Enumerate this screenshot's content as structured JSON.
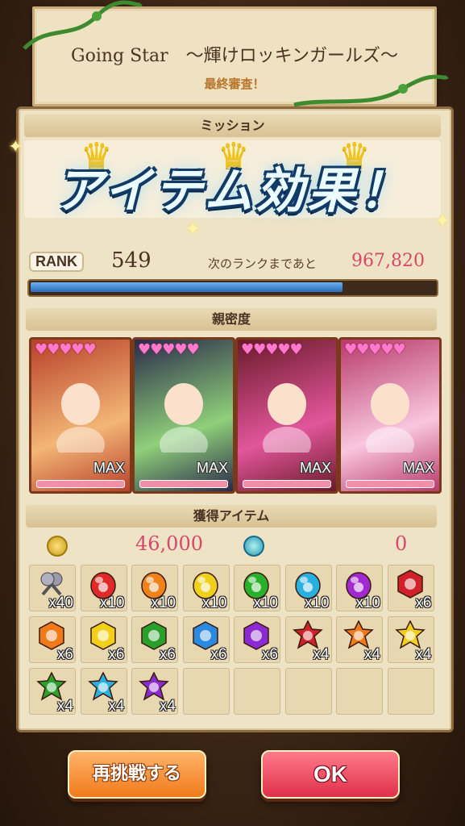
{
  "banner": {
    "title": "Going Star　〜輝けロッキンガールズ〜",
    "subtitle": "最終審査！"
  },
  "mission": {
    "header": "ミッション",
    "crowns": 3,
    "crown_icon": "crown-icon"
  },
  "overlay": {
    "text": "アイテム効果！"
  },
  "rank": {
    "label": "RANK",
    "value": "549",
    "next_label": "次のランクまであと",
    "next_value": "967,820",
    "progress": 0.77
  },
  "affinity": {
    "header": "親密度",
    "cards": [
      {
        "hearts": "♥♥♥♥♥",
        "max": "MAX",
        "colors": [
          "#b8402a",
          "#f3b676"
        ]
      },
      {
        "hearts": "♥♥♥♥♥",
        "max": "MAX",
        "colors": [
          "#2a2a4a",
          "#8fd07a"
        ]
      },
      {
        "hearts": "♥♥♥♥♥",
        "max": "MAX",
        "colors": [
          "#6a1a2a",
          "#e2569a"
        ]
      },
      {
        "hearts": "♥♥♥♥♥",
        "max": "MAX",
        "colors": [
          "#b83a6a",
          "#f9c6e0"
        ]
      }
    ]
  },
  "items": {
    "header": "獲得アイテム",
    "coin_icon": "coin-icon",
    "coin_value": "46,000",
    "gem_icon": "blue-swirl-icon",
    "gem_value": "0",
    "grid": [
      {
        "icon": "microphone-icon",
        "color": "#7a7a8a",
        "count": "x40"
      },
      {
        "icon": "red-egg-icon",
        "color": "#e02a2a",
        "count": "x10"
      },
      {
        "icon": "orange-egg-icon",
        "color": "#f0821a",
        "count": "x10"
      },
      {
        "icon": "yellow-egg-icon",
        "color": "#f0d01a",
        "count": "x10"
      },
      {
        "icon": "green-egg-icon",
        "color": "#2ab02a",
        "count": "x10"
      },
      {
        "icon": "cyan-egg-icon",
        "color": "#2ab0e0",
        "count": "x10"
      },
      {
        "icon": "purple-egg-icon",
        "color": "#a02ad0",
        "count": "x10"
      },
      {
        "icon": "red-hex-gem-icon",
        "color": "#d0202a",
        "count": "x6"
      },
      {
        "icon": "orange-hex-gem-icon",
        "color": "#f07a1a",
        "count": "x6"
      },
      {
        "icon": "yellow-hex-gem-icon",
        "color": "#f0d01a",
        "count": "x6"
      },
      {
        "icon": "green-hex-gem-icon",
        "color": "#2aa02a",
        "count": "x6"
      },
      {
        "icon": "blue-hex-gem-icon",
        "color": "#2a8ae0",
        "count": "x6"
      },
      {
        "icon": "purple-hex-gem-icon",
        "color": "#8a2ad0",
        "count": "x6"
      },
      {
        "icon": "red-star-gem-icon",
        "color": "#d0202a",
        "count": "x4"
      },
      {
        "icon": "orange-star-gem-icon",
        "color": "#f07a1a",
        "count": "x4"
      },
      {
        "icon": "yellow-star-gem-icon",
        "color": "#f0d01a",
        "count": "x4"
      },
      {
        "icon": "green-star-gem-icon",
        "color": "#2aa02a",
        "count": "x4"
      },
      {
        "icon": "cyan-star-gem-icon",
        "color": "#2ab0e0",
        "count": "x4"
      },
      {
        "icon": "purple-star-gem-icon",
        "color": "#8a2ad0",
        "count": "x4"
      },
      {
        "icon": "",
        "color": "",
        "count": ""
      },
      {
        "icon": "",
        "color": "",
        "count": ""
      },
      {
        "icon": "",
        "color": "",
        "count": ""
      },
      {
        "icon": "",
        "color": "",
        "count": ""
      },
      {
        "icon": "",
        "color": "",
        "count": ""
      }
    ]
  },
  "buttons": {
    "retry": "再挑戦する",
    "ok": "OK"
  }
}
